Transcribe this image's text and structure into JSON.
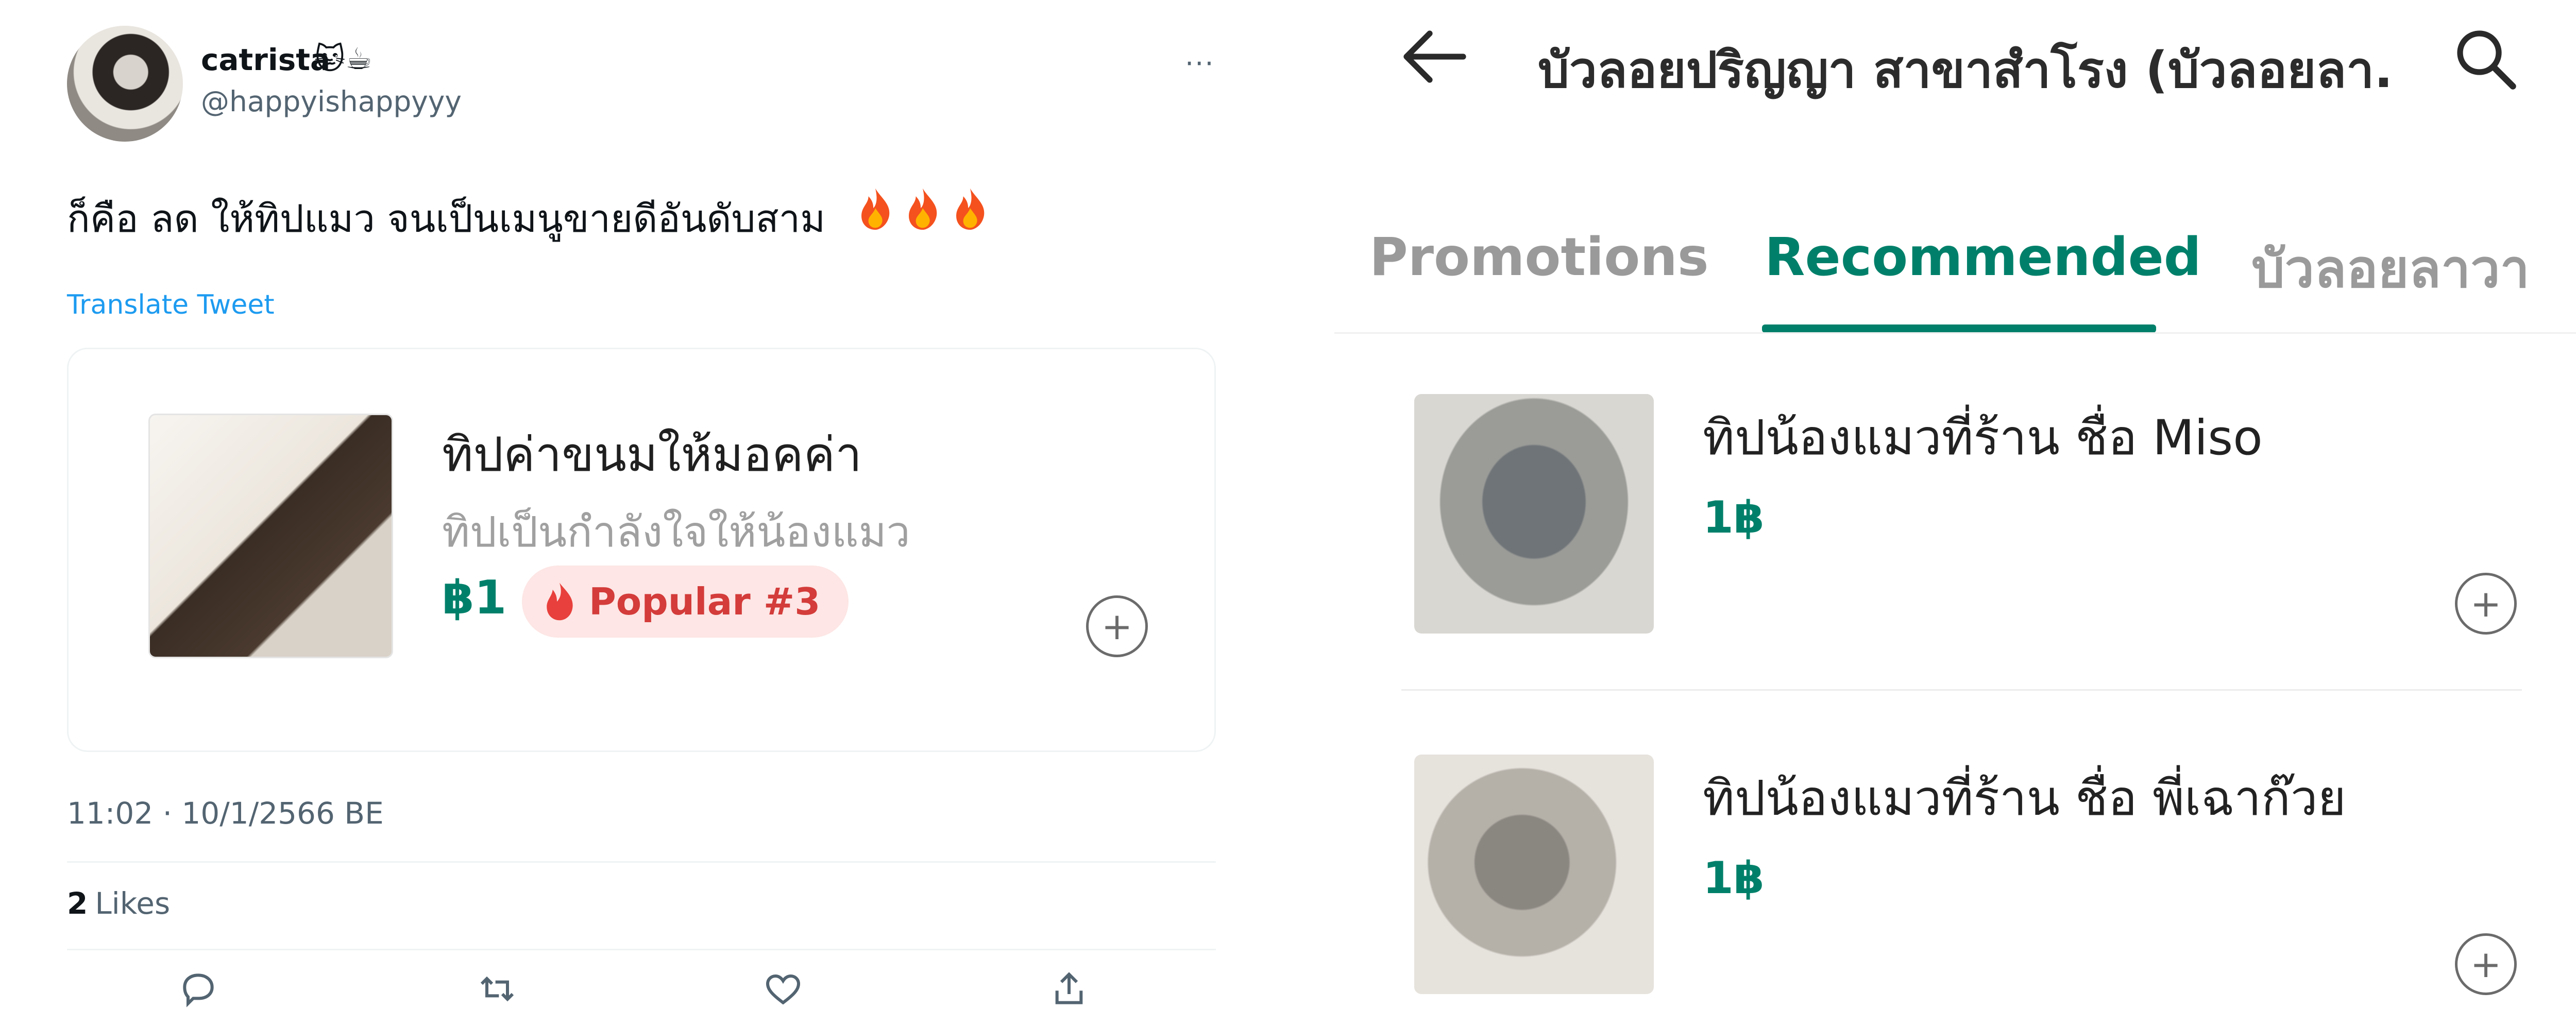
{
  "tweet": {
    "author_name": "catrista",
    "author_emoji": "🐱☕",
    "author_handle": "@happyishappyyy",
    "more_label": "···",
    "text": "ก็คือ ลด ให้ทิปแมว จนเป็นเมนูขายดีอันดับสาม",
    "fire_icons": [
      "fire-icon",
      "fire-icon",
      "fire-icon"
    ],
    "translate_label": "Translate Tweet",
    "card": {
      "title": "ทิปค่าขนมให้มอคค่า",
      "subtitle": "ทิปเป็นกำลังใจให้น้องแมว",
      "price": "฿1",
      "badge": "Popular #3",
      "add_label": "+"
    },
    "timestamp": "11:02 · 10/1/2566 BE",
    "likes_count": "2",
    "likes_label": "Likes",
    "action_icons": [
      "reply-icon",
      "retweet-icon",
      "like-icon",
      "share-icon"
    ]
  },
  "app": {
    "title": "บัวลอยปริญญา สาขาสำโรง (บัวลอยลา...",
    "tabs": [
      {
        "label": "Promotions"
      },
      {
        "label": "Recommended"
      },
      {
        "label": "บัวลอยลาวา"
      }
    ],
    "active_tab": "Recommended",
    "items": [
      {
        "title": "ทิปน้องแมวที่ร้าน ชื่อ Miso",
        "price": "1฿",
        "add_label": "+"
      },
      {
        "title": "ทิปน้องแมวที่ร้าน ชื่อ พี่เฉาก๊วย",
        "price": "1฿",
        "add_label": "+"
      }
    ]
  },
  "colors": {
    "accent_green": "#00806a",
    "badge_red": "#d33c3a",
    "badge_bg": "#fde6e5",
    "link_blue": "#1d9bf0"
  }
}
